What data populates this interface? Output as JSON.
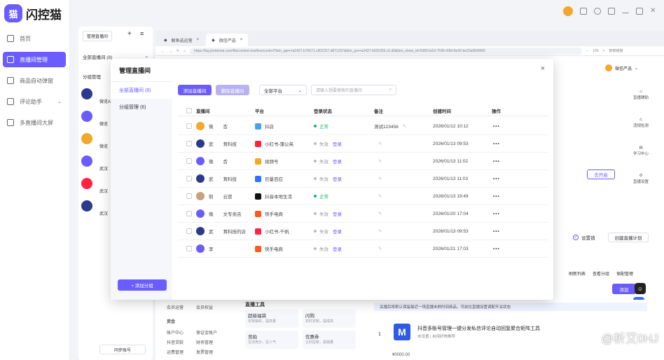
{
  "app": {
    "logo_text": "闪控猫",
    "logo_char": "猫"
  },
  "sidebar": {
    "items": [
      {
        "label": "首页"
      },
      {
        "label": "直播间管理"
      },
      {
        "label": "商品自动弹窗"
      },
      {
        "label": "评论助手"
      },
      {
        "label": "多直播间大屏"
      }
    ]
  },
  "left_panel": {
    "title": "管理直播间",
    "all_label": "全部直播间 (8)",
    "group_label": "分组管理",
    "card_names": [
      "微览A",
      "微览",
      "微览",
      "武汉",
      "武汉",
      "武汉"
    ],
    "sync_label": "同步账号"
  },
  "browser": {
    "tabs": [
      {
        "label": "鲸鱼选运营"
      },
      {
        "label": "微信严选"
      }
    ],
    "url": "https://fxg.jinritemai.com/ffa/content-tool/live/control?btm_ppre=a2427.b76571.c902327.d871297&btm_pre=a2427.b925355.c0.d0&btm_show_id=53851e53-7596-43fd-8e30-be25d384900f",
    "zoom": "100",
    "zoom_reset": "复制链接"
  },
  "modal": {
    "title": "管理直播间",
    "close": "×",
    "sidebar": [
      {
        "label": "全部直播间 (8)"
      },
      {
        "label": "分组管理 (6)"
      }
    ],
    "add_group": "+ 添加分组",
    "add_btn": "添加直播间",
    "del_btn": "删除直播间",
    "platform_select": "全部平台",
    "search_placeholder": "请输入想要搜索的直播间",
    "columns": [
      "直播间",
      "平台",
      "登录状态",
      "备注",
      "创建时间",
      "操作"
    ],
    "rows": [
      {
        "name": "微",
        "suffix": "舌",
        "platform": "抖店",
        "status": "正常",
        "ok": true,
        "note": "测试123456",
        "created": "2026/01/12 10:12",
        "color": "#f3a72b",
        "pcolor": "#4aa0f0"
      },
      {
        "name": "武",
        "suffix": "茸科技",
        "platform": "小红书-蒲公英",
        "status": "失效",
        "ok": false,
        "note": "",
        "created": "2026/01/13 09:53",
        "color": "#2d3a8c",
        "pcolor": "#ff2442"
      },
      {
        "name": "微",
        "suffix": "舌",
        "platform": "视频号",
        "status": "失效",
        "ok": false,
        "note": "",
        "created": "2026/01/13 11:02",
        "color": "#6a5cff",
        "pcolor": "#f5a623"
      },
      {
        "name": "武",
        "suffix": "茸科技",
        "platform": "巨量百应",
        "status": "失效",
        "ok": false,
        "note": "",
        "created": "2026/01/13 11:03",
        "color": "#2d3a8c",
        "pcolor": "#3370ff"
      },
      {
        "name": "刺",
        "suffix": "云营",
        "platform": "抖音本地生活",
        "status": "正常",
        "ok": true,
        "note": "",
        "created": "2026/01/13 19:49",
        "color": "#c9a27a",
        "pcolor": "#111111"
      },
      {
        "name": "微",
        "suffix": "文专卖店",
        "platform": "快手电商",
        "status": "失效",
        "ok": false,
        "note": "",
        "created": "2026/01/20 17:04",
        "color": "#6a5cff",
        "pcolor": "#ff5b1a"
      },
      {
        "name": "武",
        "suffix": "茸科技的店",
        "platform": "小红书-千帆",
        "status": "失效",
        "ok": false,
        "note": "",
        "created": "2026/01/13 09:53",
        "color": "#2d3a8c",
        "pcolor": "#ff2442"
      },
      {
        "name": "李",
        "suffix": "",
        "platform": "快手电商",
        "status": "失效",
        "ok": false,
        "note": "",
        "created": "2026/01/21 17:03",
        "color": "#6a5cff",
        "pcolor": "#ff5b1a"
      }
    ],
    "login_label": "登录",
    "more": "•••"
  },
  "behind": {
    "store_name": "微信严选",
    "right_sidebar": [
      "直播辅助",
      "违规检测",
      "学习中心",
      "直播设置"
    ],
    "open_btn": "去开启",
    "settings_label": "设置销",
    "create_plan": "创建直播计划",
    "refresh": "刷新列表",
    "view_groups": "查看分组",
    "pin_label": "保配管理",
    "add_btn": "添加",
    "pagination": "< 1/1 >",
    "notice": "关播后将默认保留最近一场直播未刷时间商品，可前往直播设置调配开关状态",
    "product_name": "抖音多账号管理一键分发私信评论自动回复聚合矩阵工具",
    "product_sub": "未设置 | 自用好物推荐",
    "product_idx": "1",
    "price": "¥0000.00",
    "tools_title": "直播工具",
    "tools": [
      {
        "title": "超级福袋",
        "sub": "实物抽奖，提高量"
      },
      {
        "title": "闪购",
        "sub": "实时定制，提成高"
      },
      {
        "title": "竞拍",
        "sub": "互动竞价，拉人气"
      },
      {
        "title": "优惠券",
        "sub": "让利拉新，提销量"
      }
    ],
    "bottom_labels": [
      "会员运营",
      "会员权益",
      "资金",
      "账户中心",
      "保证金账户",
      "抖音贷款",
      "财务管理",
      "运费管理",
      "发票管理"
    ]
  },
  "watermark": "@析艾0HJ"
}
